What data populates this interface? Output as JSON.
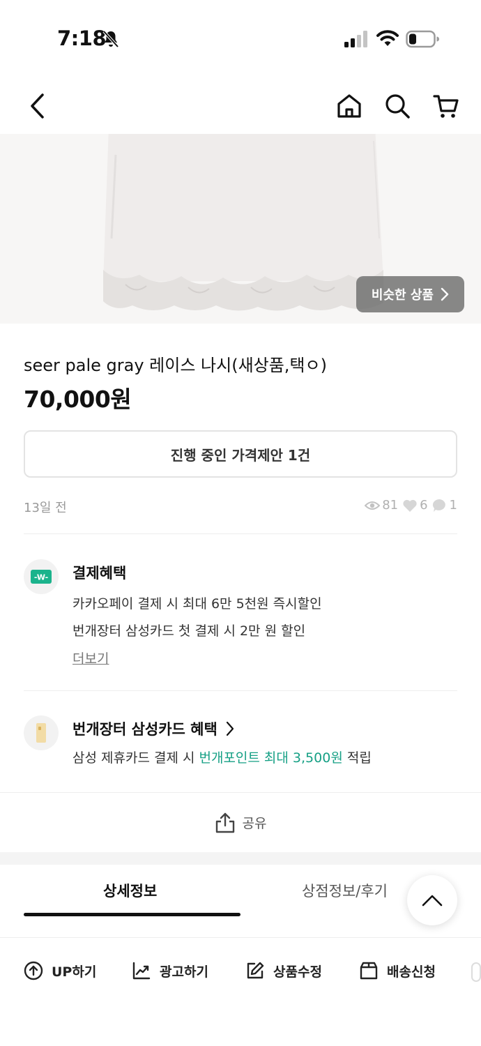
{
  "status_bar": {
    "time": "7:18"
  },
  "product": {
    "similar_label": "비슷한 상품",
    "title": "seer pale gray 레이스 나시(새상품,택ㅇ)",
    "price": "70,000원",
    "offer_label": "진행 중인 가격제안 1건",
    "posted": "13일 전",
    "stats": {
      "views": "81",
      "likes": "6",
      "chats": "1"
    }
  },
  "payment_benefit": {
    "title": "결제혜택",
    "lines": [
      "카카오페이 결제 시 최대 6만 5천원 즉시할인",
      "번개장터 삼성카드 첫 결제 시 2만 원  할인"
    ],
    "more": "더보기"
  },
  "card_benefit": {
    "title": "번개장터 삼성카드 혜택",
    "line_prefix": "삼성 제휴카드 결제 시 ",
    "line_highlight": "번개포인트 최대 3,500원",
    "line_suffix": " 적립"
  },
  "share_label": "공유",
  "tabs": {
    "detail": "상세정보",
    "store": "상점정보/후기"
  },
  "actions": {
    "up": "UP하기",
    "ad": "광고하기",
    "edit": "상품수정",
    "delivery": "배송신청"
  },
  "colors": {
    "accent_green": "#16a085",
    "text": "#111111",
    "muted": "#9a9a9a"
  }
}
